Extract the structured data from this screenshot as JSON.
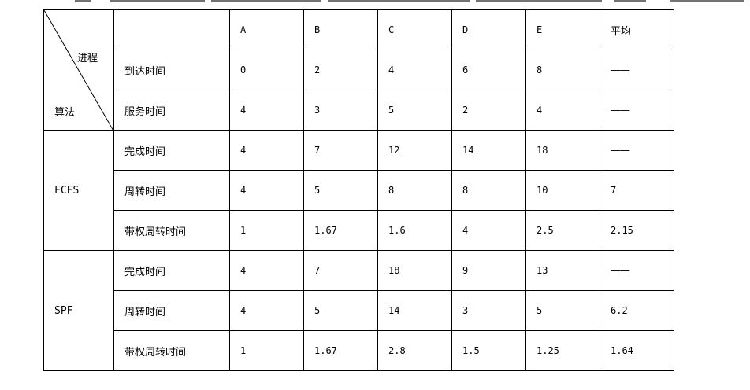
{
  "table": {
    "corner_top": "进程",
    "corner_bottom": "算法",
    "columns": [
      "A",
      "B",
      "C",
      "D",
      "E",
      "平均"
    ],
    "base_rows": [
      {
        "label": "到达时间",
        "values": [
          "0",
          "2",
          "4",
          "6",
          "8",
          "——"
        ]
      },
      {
        "label": "服务时间",
        "values": [
          "4",
          "3",
          "5",
          "2",
          "4",
          "——"
        ]
      }
    ],
    "groups": [
      {
        "algorithm": "FCFS",
        "rows": [
          {
            "label": "完成时间",
            "values": [
              "4",
              "7",
              "12",
              "14",
              "18",
              "——"
            ]
          },
          {
            "label": "周转时间",
            "values": [
              "4",
              "5",
              "8",
              "8",
              "10",
              "7"
            ]
          },
          {
            "label": "带权周转时间",
            "values": [
              "1",
              "1.67",
              "1.6",
              "4",
              "2.5",
              "2.15"
            ]
          }
        ]
      },
      {
        "algorithm": "SPF",
        "rows": [
          {
            "label": "完成时间",
            "values": [
              "4",
              "7",
              "18",
              "9",
              "13",
              "——"
            ]
          },
          {
            "label": "周转时间",
            "values": [
              "4",
              "5",
              "14",
              "3",
              "5",
              "6.2"
            ]
          },
          {
            "label": "带权周转时间",
            "values": [
              "1",
              "1.67",
              "2.8",
              "1.5",
              "1.25",
              "1.64"
            ]
          }
        ]
      }
    ]
  }
}
